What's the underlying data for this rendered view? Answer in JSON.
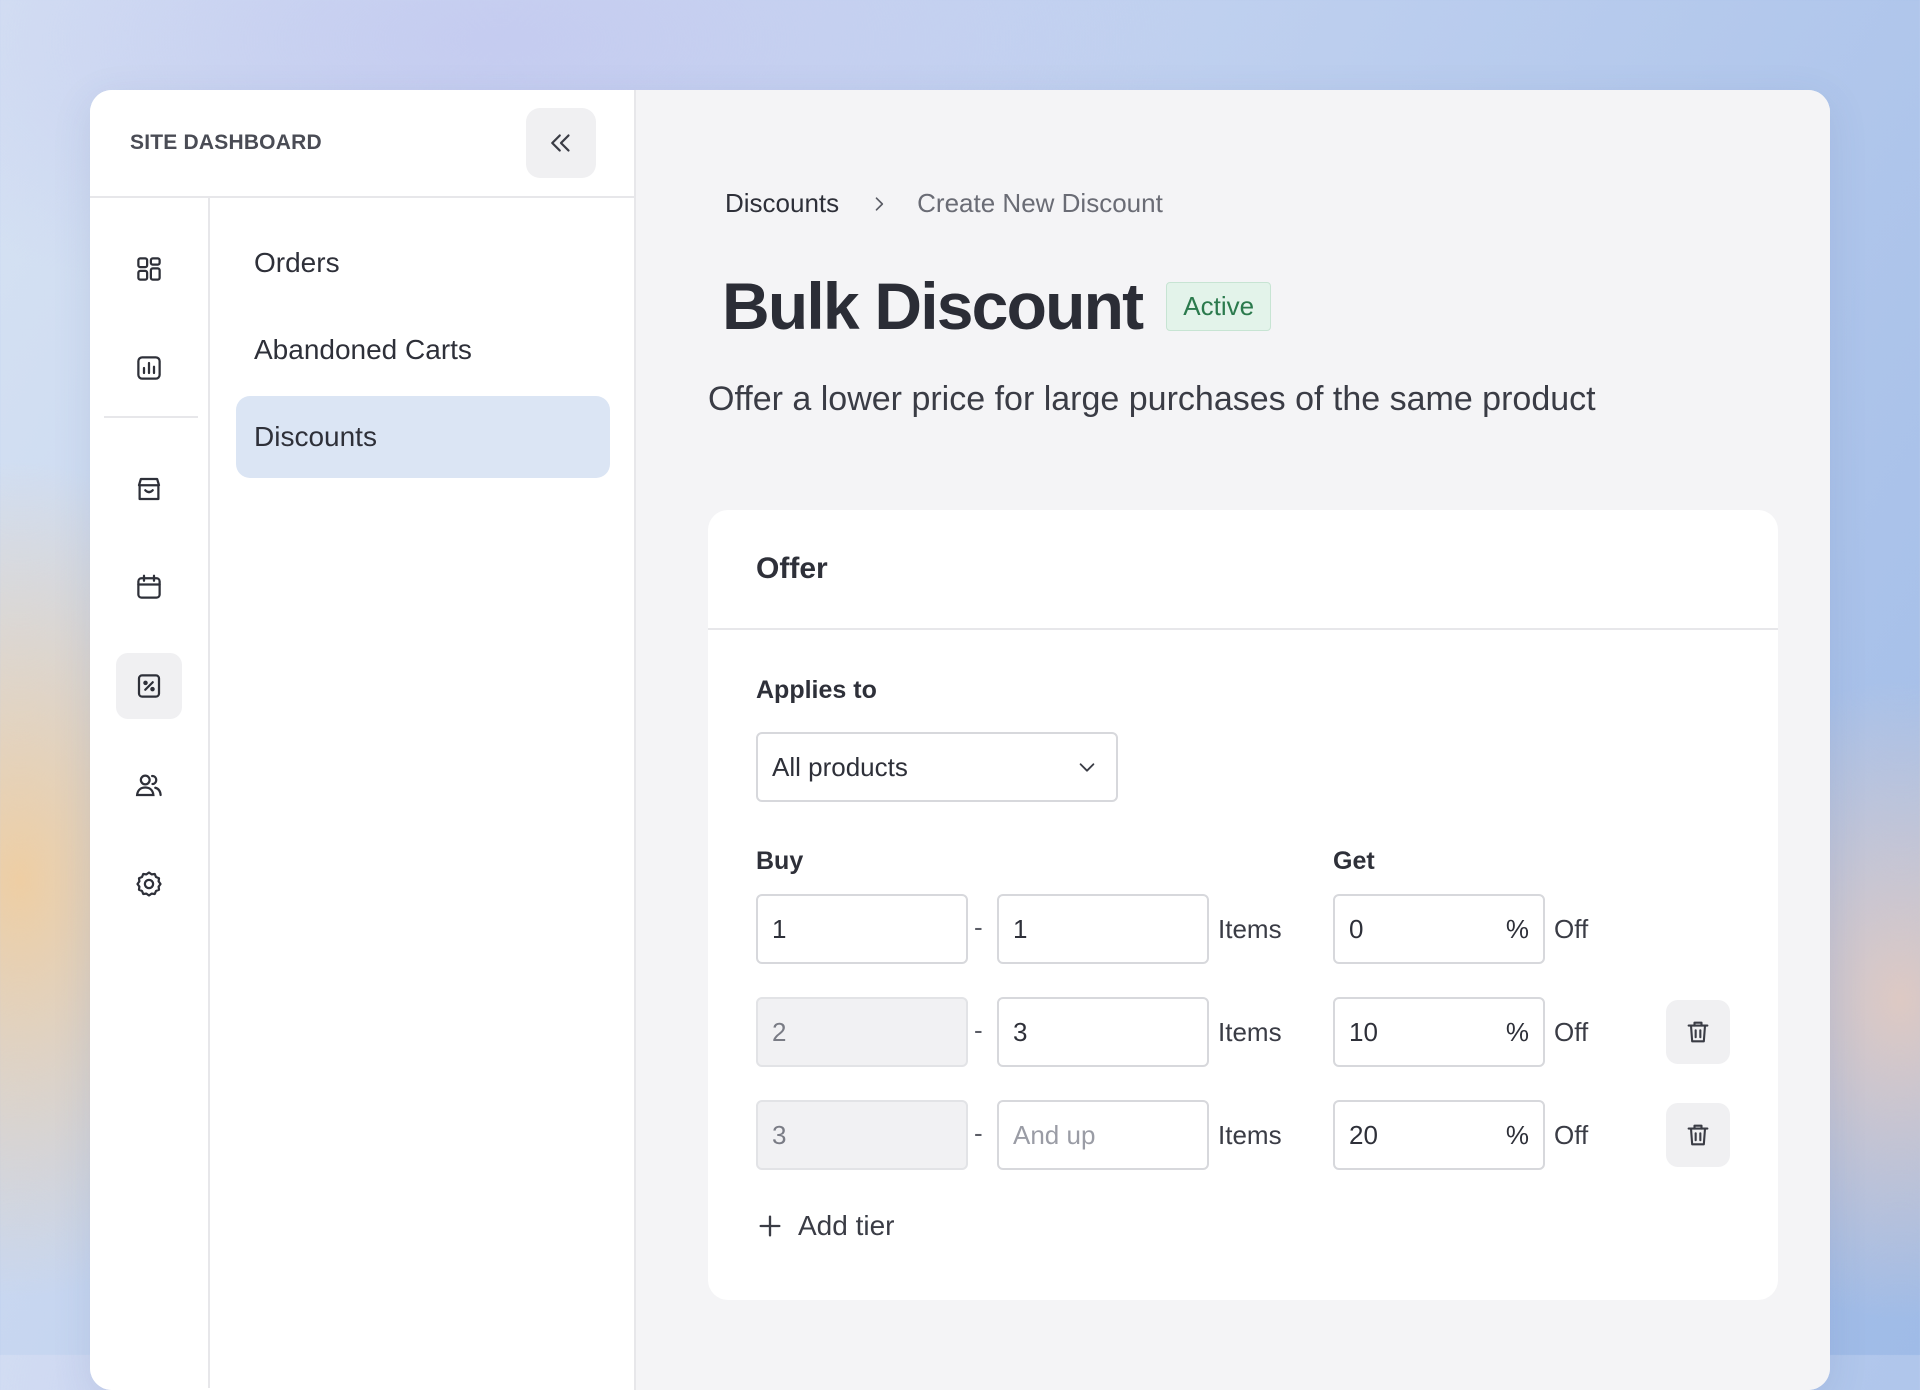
{
  "sidebar": {
    "site_title": "SITE DASHBOARD",
    "rail_icons": [
      "dashboard-icon",
      "analytics-icon",
      "store-icon",
      "calendar-icon",
      "discount-icon",
      "users-icon",
      "settings-icon"
    ],
    "active_rail_icon": "discount-icon",
    "subnav": {
      "items": [
        {
          "label": "Orders"
        },
        {
          "label": "Abandoned Carts"
        },
        {
          "label": "Discounts"
        }
      ],
      "active_index": 2
    }
  },
  "breadcrumb": {
    "parent": "Discounts",
    "current": "Create New Discount"
  },
  "page": {
    "title": "Bulk Discount",
    "status": "Active",
    "subtitle": "Offer a lower price for large purchases of the same product"
  },
  "offer": {
    "heading": "Offer",
    "applies_to_label": "Applies to",
    "applies_to_value": "All products",
    "buy_label": "Buy",
    "get_label": "Get",
    "unit_items": "Items",
    "unit_off": "Off",
    "percent_symbol": "%",
    "dash": "-",
    "tiers": [
      {
        "from": "1",
        "to": "1",
        "to_placeholder": "",
        "percent": "0",
        "from_editable": true,
        "deletable": false
      },
      {
        "from": "2",
        "to": "3",
        "to_placeholder": "",
        "percent": "10",
        "from_editable": false,
        "deletable": true
      },
      {
        "from": "3",
        "to": "",
        "to_placeholder": "And up",
        "percent": "20",
        "from_editable": false,
        "deletable": true
      }
    ],
    "add_tier_label": "Add tier"
  },
  "colors": {
    "active_nav_bg": "#dbe5f4",
    "status_badge_bg": "#e3f3ea",
    "status_badge_text": "#2b7a4d",
    "main_bg": "#f4f4f6"
  }
}
